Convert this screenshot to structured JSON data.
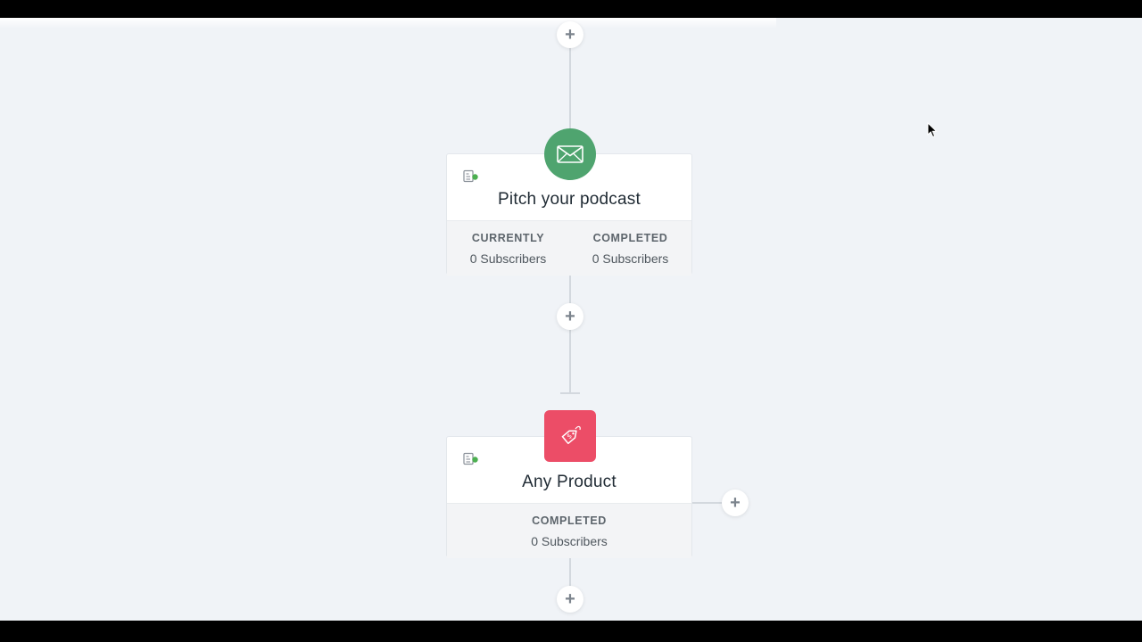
{
  "colors": {
    "canvas": "#f0f3f7",
    "email_badge": "#4fa46f",
    "product_badge": "#ec4d67",
    "status_dot": "#4caf50",
    "connector": "#d3d8de"
  },
  "workflow": {
    "nodes": [
      {
        "type": "email",
        "icon": "envelope-icon",
        "title": "Pitch your podcast",
        "stats": [
          {
            "label": "CURRENTLY",
            "value": "0 Subscribers"
          },
          {
            "label": "COMPLETED",
            "value": "0 Subscribers"
          }
        ]
      },
      {
        "type": "purchase",
        "icon": "price-tag-icon",
        "title": "Any Product",
        "stats": [
          {
            "label": "COMPLETED",
            "value": "0 Subscribers"
          }
        ]
      }
    ],
    "add_step_symbol": "+"
  }
}
